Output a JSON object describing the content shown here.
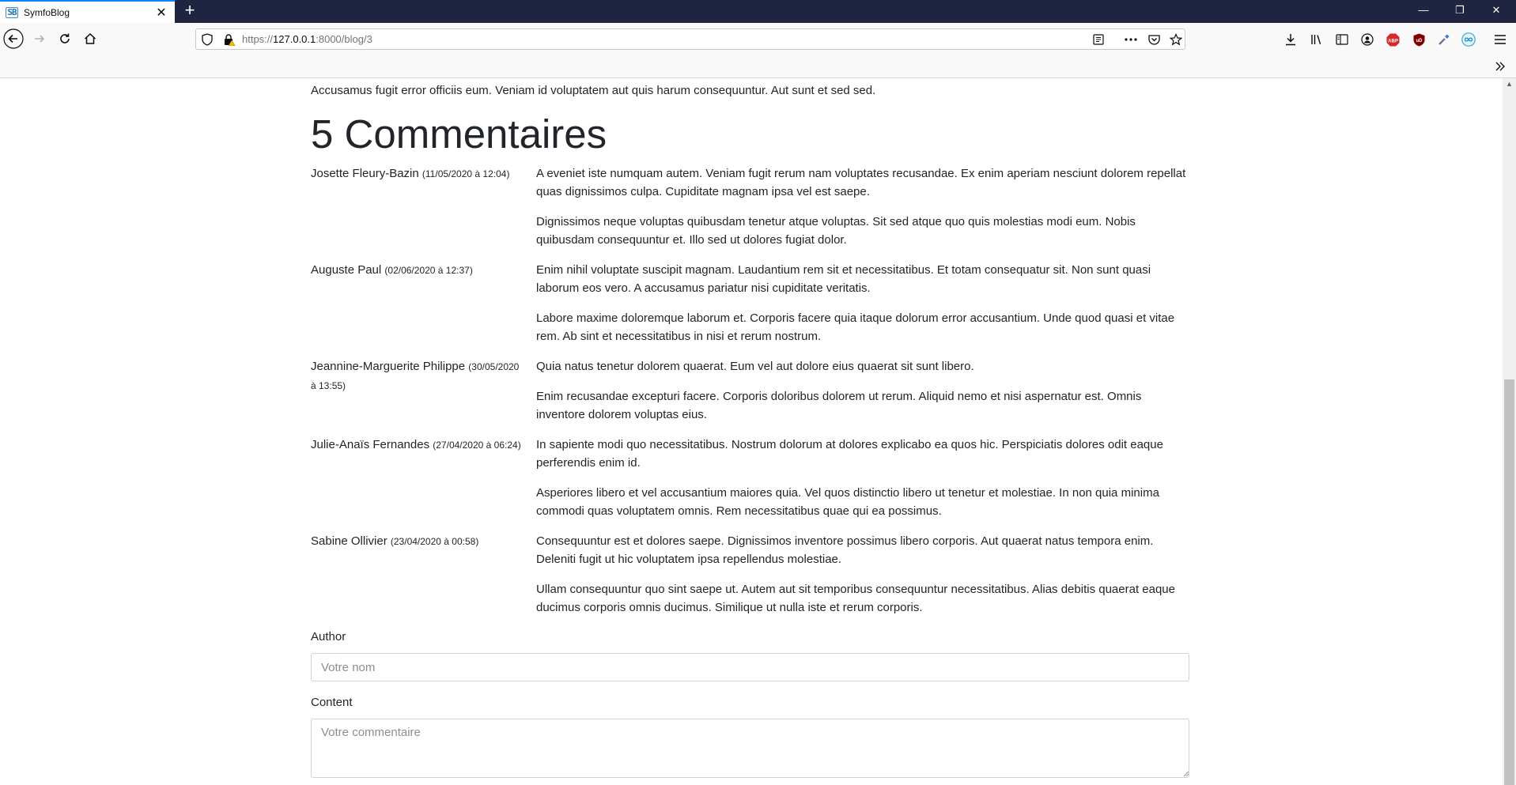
{
  "browser": {
    "tab_title": "SymfoBlog",
    "favicon_text": "SB",
    "url_prefix": "https://",
    "url_host": "127.0.0.1",
    "url_rest": ":8000/blog/3",
    "extension_abp": "ABP",
    "extension_ublock": "uD"
  },
  "article": {
    "last_paragraph": "Accusamus fugit error officiis eum. Veniam id voluptatem aut quis harum consequuntur. Aut sunt et sed sed."
  },
  "comments_heading": "5 Commentaires",
  "comments": [
    {
      "author": "Josette Fleury-Bazin",
      "date": "(11/05/2020 à 12:04)",
      "paragraphs": [
        "A eveniet iste numquam autem. Veniam fugit rerum nam voluptates recusandae. Ex enim aperiam nesciunt dolorem repellat quas dignissimos culpa. Cupiditate magnam ipsa vel est saepe.",
        "Dignissimos neque voluptas quibusdam tenetur atque voluptas. Sit sed atque quo quis molestias modi eum. Nobis quibusdam consequuntur et. Illo sed ut dolores fugiat dolor."
      ]
    },
    {
      "author": "Auguste Paul",
      "date": "(02/06/2020 à 12:37)",
      "paragraphs": [
        "Enim nihil voluptate suscipit magnam. Laudantium rem sit et necessitatibus. Et totam consequatur sit. Non sunt quasi laborum eos vero. A accusamus pariatur nisi cupiditate veritatis.",
        "Labore maxime doloremque laborum et. Corporis facere quia itaque dolorum error accusantium. Unde quod quasi et vitae rem. Ab sint et necessitatibus in nisi et rerum nostrum."
      ]
    },
    {
      "author": "Jeannine-Marguerite Philippe",
      "date": "(30/05/2020 à 13:55)",
      "paragraphs": [
        "Quia natus tenetur dolorem quaerat. Eum vel aut dolore eius quaerat sit sunt libero.",
        "Enim recusandae excepturi facere. Corporis doloribus dolorem ut rerum. Aliquid nemo et nisi aspernatur est. Omnis inventore dolorem voluptas eius."
      ]
    },
    {
      "author": "Julie-Anaïs Fernandes",
      "date": "(27/04/2020 à 06:24)",
      "paragraphs": [
        "In sapiente modi quo necessitatibus. Nostrum dolorum at dolores explicabo ea quos hic. Perspiciatis dolores odit eaque perferendis enim id.",
        "Asperiores libero et vel accusantium maiores quia. Vel quos distinctio libero ut tenetur et molestiae. In non quia minima commodi quas voluptatem omnis. Rem necessitatibus quae qui ea possimus."
      ]
    },
    {
      "author": "Sabine Ollivier",
      "date": "(23/04/2020 à 00:58)",
      "paragraphs": [
        "Consequuntur est et dolores saepe. Dignissimos inventore possimus libero corporis. Aut quaerat natus tempora enim. Deleniti fugit ut hic voluptatem ipsa repellendus molestiae.",
        "Ullam consequuntur quo sint saepe ut. Autem aut sit temporibus consequuntur necessitatibus. Alias debitis quaerat eaque ducimus corporis omnis ducimus. Similique ut nulla iste et rerum corporis."
      ]
    }
  ],
  "form": {
    "author_label": "Author",
    "author_placeholder": "Votre nom",
    "author_value": "",
    "content_label": "Content",
    "content_placeholder": "Votre commentaire",
    "content_value": ""
  }
}
